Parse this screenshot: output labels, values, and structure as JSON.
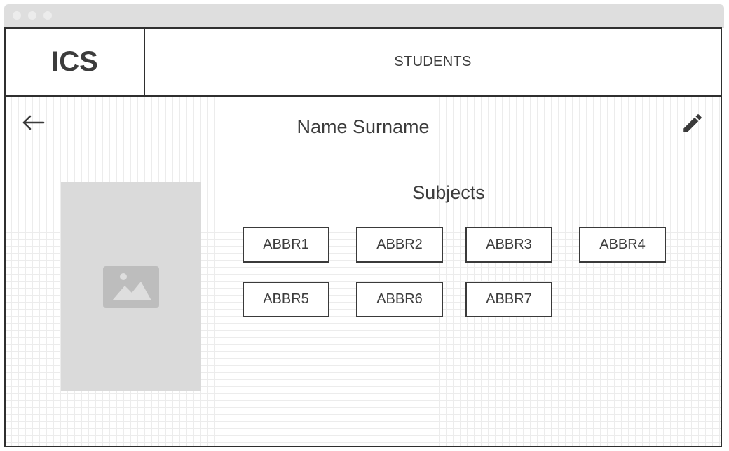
{
  "app": {
    "logo": "ICS"
  },
  "nav": {
    "students_label": "STUDENTS"
  },
  "page": {
    "title": "Name Surname",
    "back_icon": "arrow-left-icon",
    "edit_icon": "pencil-icon",
    "photo_icon": "image-placeholder-icon"
  },
  "subjects": {
    "heading": "Subjects",
    "items": [
      {
        "label": "ABBR1"
      },
      {
        "label": "ABBR2"
      },
      {
        "label": "ABBR3"
      },
      {
        "label": "ABBR4"
      },
      {
        "label": "ABBR5"
      },
      {
        "label": "ABBR6"
      },
      {
        "label": "ABBR7"
      }
    ]
  },
  "colors": {
    "border": "#2f2f2f",
    "text": "#3c3c3c",
    "placeholder": "#dadada",
    "placeholder_icon": "#bdbdbd",
    "window_chrome": "#dedede"
  }
}
